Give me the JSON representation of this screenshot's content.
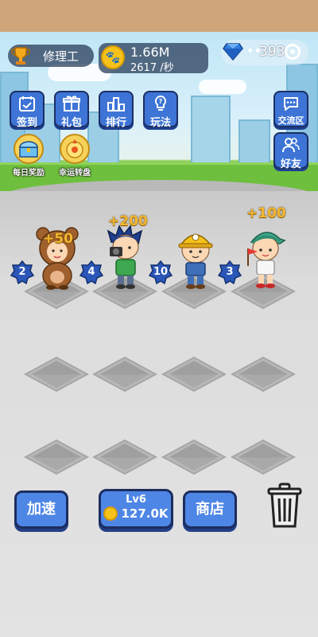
{
  "header": {
    "job_title": "修理工",
    "coins": "1.66M",
    "coin_rate": "2617 /秒",
    "gems_dots": "••",
    "gems": "393"
  },
  "left_buttons": [
    {
      "label": "签到",
      "icon": "calendar-icon"
    },
    {
      "label": "礼包",
      "icon": "gift-icon"
    },
    {
      "label": "排行",
      "icon": "podium-icon"
    },
    {
      "label": "玩法",
      "icon": "lightbulb-icon"
    }
  ],
  "round_buttons": [
    {
      "label": "每日奖励",
      "icon": "treasure-chest-icon"
    },
    {
      "label": "幸运转盘",
      "icon": "lucky-wheel-icon"
    }
  ],
  "right_buttons": [
    {
      "label": "交流区",
      "icon": "chat-bubble-icon"
    },
    {
      "label": "好友",
      "icon": "friends-icon"
    }
  ],
  "characters": [
    {
      "level": "2",
      "name": "bear-costume-kid",
      "plus": "+50"
    },
    {
      "level": "4",
      "name": "photographer-boy",
      "plus": "+200"
    },
    {
      "level": "10",
      "name": "miner-boy",
      "plus": ""
    },
    {
      "level": "3",
      "name": "flag-boy",
      "plus": "+100"
    }
  ],
  "bottom": {
    "speed_label": "加速",
    "buy_level": "Lv6",
    "buy_price": "127.0K",
    "shop_label": "商店"
  },
  "colors": {
    "button_blue": "#3d74d6",
    "badge_blue": "#2b57b8",
    "gold": "#f2b632"
  }
}
